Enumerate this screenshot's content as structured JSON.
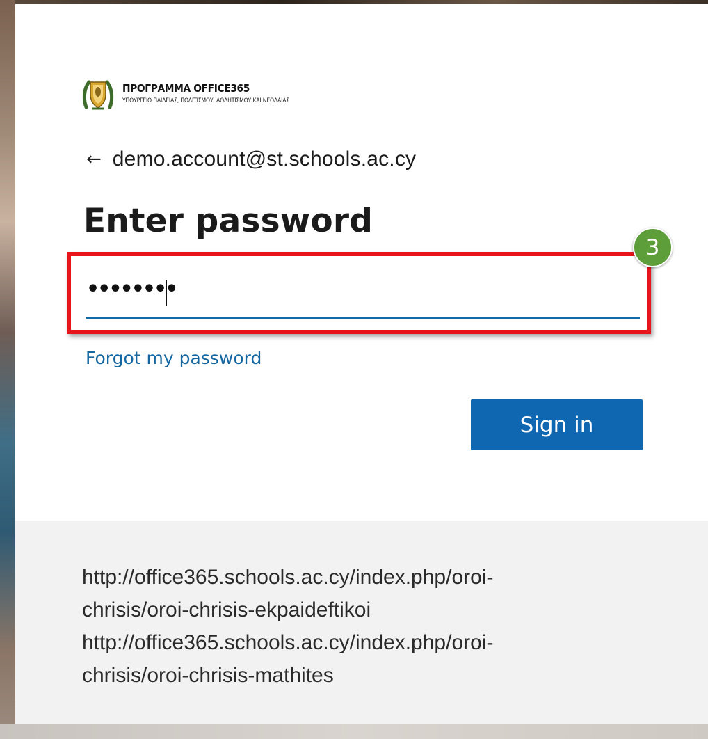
{
  "branding": {
    "title": "ΠΡΟΓΡΑΜΜΑ OFFICE365",
    "subtitle": "ΥΠΟΥΡΓΕΙΟ ΠΑΙΔΕΙΑΣ, ΠΟΛΙΤΙΣΜΟΥ, ΑΘΛΗΤΙΣΜΟΥ ΚΑΙ ΝΕΟΛΑΙΑΣ",
    "logo_icon": "cyprus-coat-of-arms-icon"
  },
  "identity": {
    "back_icon": "arrow-left-icon",
    "back_glyph": "←",
    "email": "demo.account@st.schools.ac.cy"
  },
  "page_title": "Enter password",
  "password_field": {
    "masked_value": "••••••••",
    "type": "password"
  },
  "annotation": {
    "step_number": "3",
    "highlight_color": "#e8141b",
    "badge_color": "#5d9d3a"
  },
  "forgot_link": "Forgot my password",
  "sign_in_button": "Sign in",
  "footer": {
    "lines": [
      "http://office365.schools.ac.cy/index.php/oroi-",
      "chrisis/oroi-chrisis-ekpaideftikoi",
      "http://office365.schools.ac.cy/index.php/oroi-",
      "chrisis/oroi-chrisis-mathites"
    ]
  },
  "colors": {
    "accent": "#0f67b1",
    "link": "#1366a0",
    "footer_bg": "#f2f2f2"
  }
}
